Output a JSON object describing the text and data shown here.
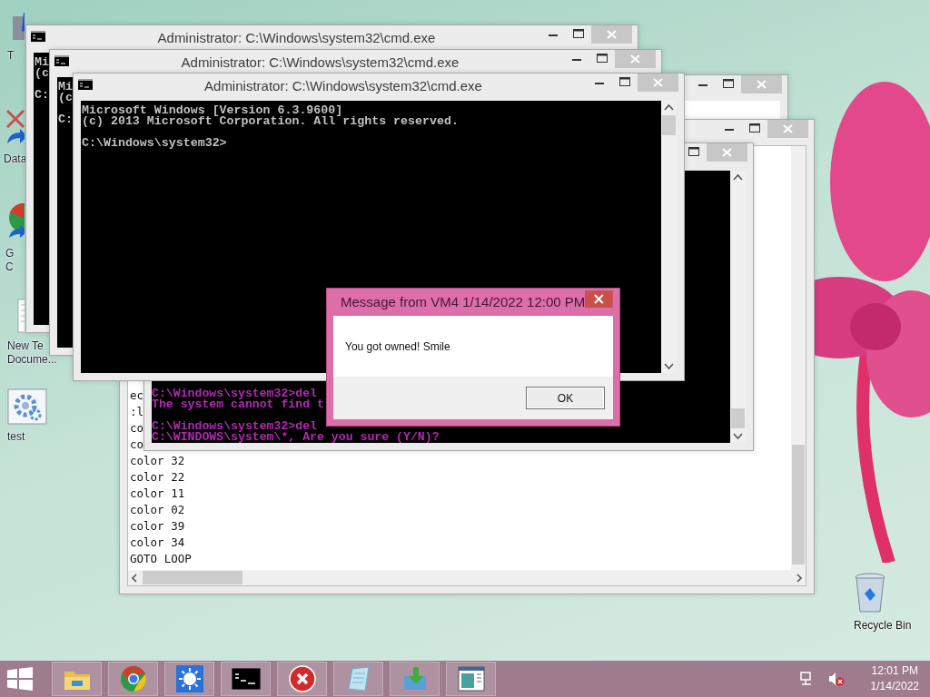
{
  "desktop_icons": [
    {
      "kind": "program",
      "lines": [
        "T"
      ]
    },
    {
      "kind": "shortcut",
      "lines": [
        "Data"
      ]
    },
    {
      "kind": "chrome",
      "lines": [
        "G",
        "C"
      ]
    },
    {
      "kind": "text-file",
      "lines": [
        "New Te",
        "Docume..."
      ]
    },
    {
      "kind": "gear",
      "lines": [
        "test"
      ]
    },
    {
      "kind": "recycle-bin",
      "lines": [
        "Recycle Bin"
      ]
    }
  ],
  "windows": [
    {
      "kind": "console",
      "title": "Administrator: C:\\Windows\\system32\\cmd.exe",
      "blocks": [
        [
          "Mi",
          "(c"
        ],
        [
          "C:"
        ]
      ]
    },
    {
      "kind": "console",
      "title": "Administrator: C:\\Windows\\system32\\cmd.exe",
      "blocks": [
        [
          "Mi",
          "(c"
        ],
        [
          "C:"
        ]
      ]
    },
    {
      "kind": "console",
      "title": "Administrator: C:\\Windows\\system32\\cmd.exe",
      "color": "#c0c0c0",
      "blocks": [
        [
          "Microsoft Windows [Version 6.3.9600]",
          "(c) 2013 Microsoft Corporation. All rights reserved."
        ],
        [
          "C:\\Windows\\system32>"
        ]
      ]
    },
    {
      "kind": "blank"
    },
    {
      "kind": "notepad",
      "lines": [
        "ec",
        ":l",
        "co",
        "co",
        "color 32",
        "color 22",
        "color 11",
        "color 02",
        "color 39",
        "color 34",
        "GOTO LOOP"
      ]
    },
    {
      "kind": "console",
      "color": "#b428b4",
      "blocks": [
        [
          "C:\\Windows\\system32>del",
          "The system cannot find t"
        ],
        [
          "C:\\Windows\\system32>del",
          "C:\\WINDOWS\\system\\*, Are you sure (Y/N)?"
        ]
      ]
    }
  ],
  "dialog": {
    "title": "Message from VM4 1/14/2022 12:00 PM",
    "message": "You got owned! Smile",
    "button": "OK"
  },
  "taskbar": {
    "buttons": [
      {
        "kind": "start"
      },
      {
        "kind": "folder"
      },
      {
        "kind": "chrome"
      },
      {
        "kind": "sun"
      },
      {
        "kind": "console"
      },
      {
        "kind": "error"
      },
      {
        "kind": "notepad"
      },
      {
        "kind": "download"
      },
      {
        "kind": "window"
      }
    ],
    "tray": [
      {
        "kind": "network"
      },
      {
        "kind": "volume-muted"
      }
    ],
    "clock": {
      "time": "12:01 PM",
      "date": "1/14/2022"
    }
  }
}
